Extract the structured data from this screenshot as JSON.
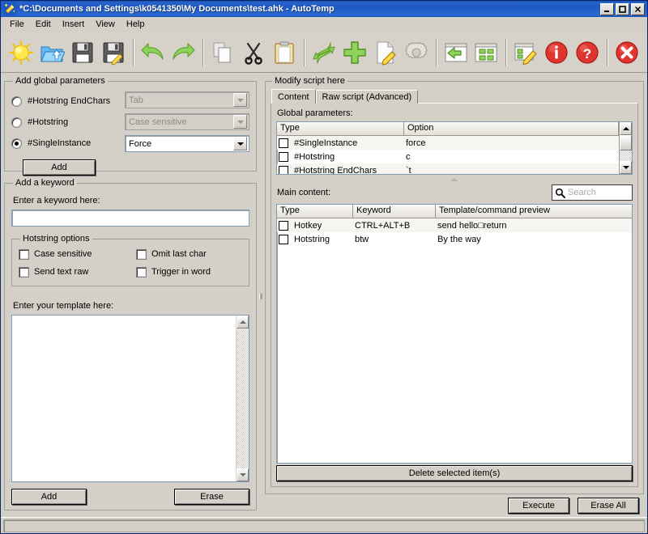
{
  "window": {
    "title": "*C:\\Documents and Settings\\k0541350\\My Documents\\test.ahk - AutoTemp",
    "icon": "magic-wand-icon",
    "minimize_label": "_",
    "maximize_label": "□",
    "close_label": "X"
  },
  "menu": {
    "items": [
      {
        "label": "File"
      },
      {
        "label": "Edit"
      },
      {
        "label": "Insert"
      },
      {
        "label": "View"
      },
      {
        "label": "Help"
      }
    ]
  },
  "toolbar": {
    "groups": [
      {
        "buttons": [
          {
            "name": "new-script-button",
            "icon": "sun-icon"
          },
          {
            "name": "open-script-button",
            "icon": "open-folder-icon"
          },
          {
            "name": "save-button",
            "icon": "floppy-disk-icon"
          },
          {
            "name": "save-as-button",
            "icon": "floppy-disk-pencil-icon"
          }
        ]
      },
      {
        "buttons": [
          {
            "name": "undo-button",
            "icon": "undo-arrow-icon"
          },
          {
            "name": "redo-button",
            "icon": "redo-arrow-icon"
          }
        ]
      },
      {
        "buttons": [
          {
            "name": "copy-button",
            "icon": "copy-pages-icon"
          },
          {
            "name": "cut-button",
            "icon": "scissors-icon"
          },
          {
            "name": "paste-button",
            "icon": "clipboard-icon"
          }
        ]
      },
      {
        "buttons": [
          {
            "name": "refresh-button",
            "icon": "refresh-arrows-icon"
          },
          {
            "name": "add-button",
            "icon": "green-plus-icon"
          },
          {
            "name": "edit-button",
            "icon": "page-pencil-icon"
          },
          {
            "name": "settings-button",
            "icon": "gear-icon"
          }
        ]
      },
      {
        "buttons": [
          {
            "name": "back-button",
            "icon": "left-arrow-window-icon"
          },
          {
            "name": "grid-view-button",
            "icon": "grid-window-icon"
          }
        ]
      },
      {
        "buttons": [
          {
            "name": "edit-script-button",
            "icon": "window-pencil-icon"
          },
          {
            "name": "info-button",
            "icon": "info-circle-icon"
          },
          {
            "name": "help-button",
            "icon": "question-circle-icon"
          }
        ]
      },
      {
        "buttons": [
          {
            "name": "exit-button",
            "icon": "close-circle-icon"
          }
        ]
      }
    ]
  },
  "left": {
    "global_params": {
      "legend": "Add global parameters",
      "options": [
        {
          "label": "#Hotstring EndChars",
          "checked": false,
          "combo_value": "Tab",
          "combo_disabled": true
        },
        {
          "label": "#Hotstring",
          "checked": false,
          "combo_value": "Case sensitive",
          "combo_disabled": true
        },
        {
          "label": "#SingleInstance",
          "checked": true,
          "combo_value": "Force",
          "combo_disabled": false
        }
      ],
      "add_label": "Add"
    },
    "keyword": {
      "legend": "Add a keyword",
      "enter_label": "Enter a keyword here:",
      "input_value": "",
      "input_placeholder": "",
      "hotstring_legend": "Hotstring options",
      "checkboxes": [
        {
          "label": "Case sensitive",
          "checked": false
        },
        {
          "label": "Omit last char",
          "checked": false
        },
        {
          "label": "Send text raw",
          "checked": false
        },
        {
          "label": "Trigger in word",
          "checked": false
        }
      ],
      "template_label": "Enter your template here:",
      "template_value": "",
      "add_label": "Add",
      "erase_label": "Erase"
    }
  },
  "right": {
    "legend": "Modify script here",
    "tabs": [
      {
        "label": "Content",
        "active": true
      },
      {
        "label": "Raw script (Advanced)",
        "active": false
      }
    ],
    "global_params": {
      "label": "Global parameters:",
      "columns": [
        "Type",
        "Option"
      ],
      "rows": [
        {
          "checked": false,
          "type": "#SingleInstance",
          "option": "force"
        },
        {
          "checked": false,
          "type": "#Hotstring",
          "option": "c"
        },
        {
          "checked": false,
          "type": "#Hotstring EndChars",
          "option": "`t"
        }
      ]
    },
    "main_content": {
      "label": "Main content:",
      "search_placeholder": "Search",
      "search_value": "",
      "columns": [
        "Type",
        "Keyword",
        "Template/command preview"
      ],
      "rows": [
        {
          "checked": false,
          "type": "Hotkey",
          "keyword": "CTRL+ALT+B",
          "preview": "send hello□return"
        },
        {
          "checked": false,
          "type": "Hotstring",
          "keyword": "btw",
          "preview": "By the way"
        }
      ],
      "delete_label": "Delete selected item(s)"
    },
    "execute_label": "Execute",
    "erase_all_label": "Erase All"
  },
  "statusbar": {
    "text": ""
  },
  "colors": {
    "title_bar": "#1d58c4",
    "face": "#d4d0c8",
    "accent_green": "#6fbf2a",
    "accent_red": "#d93f3f",
    "field_border": "#7f9db9"
  }
}
